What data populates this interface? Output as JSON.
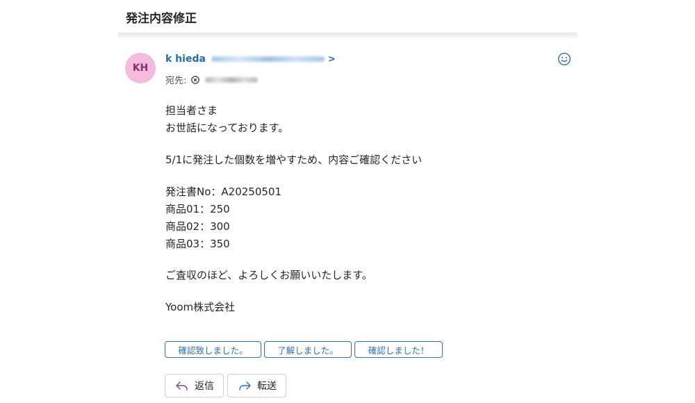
{
  "email": {
    "subject": "発注内容修正",
    "sender": {
      "initials": "KH",
      "name": "k hieda"
    },
    "to_label": "宛先:"
  },
  "body": {
    "greeting": "担当者さま",
    "intro": "お世話になっております。",
    "request": "5/1に発注した個数を増やすため、内容ご確認ください",
    "order_no": "発注書No：A20250501",
    "items": [
      "商品01：250",
      "商品02：300",
      "商品03：350"
    ],
    "closing": "ご査収のほど、よろしくお願いいたします。",
    "signature": "Yoom株式会社"
  },
  "quick_replies": [
    "確認致しました。",
    "了解しました。",
    "確認しました！"
  ],
  "actions": {
    "reply": "返信",
    "forward": "転送"
  },
  "icons": {
    "emoji": "smiley-icon",
    "remove_recipient": "remove-recipient-icon",
    "reply": "reply-arrow-icon",
    "forward": "forward-arrow-icon"
  },
  "colors": {
    "avatar_bg": "#f3bbde",
    "link": "#1f6bb8",
    "accent": "#2e6fb3"
  }
}
